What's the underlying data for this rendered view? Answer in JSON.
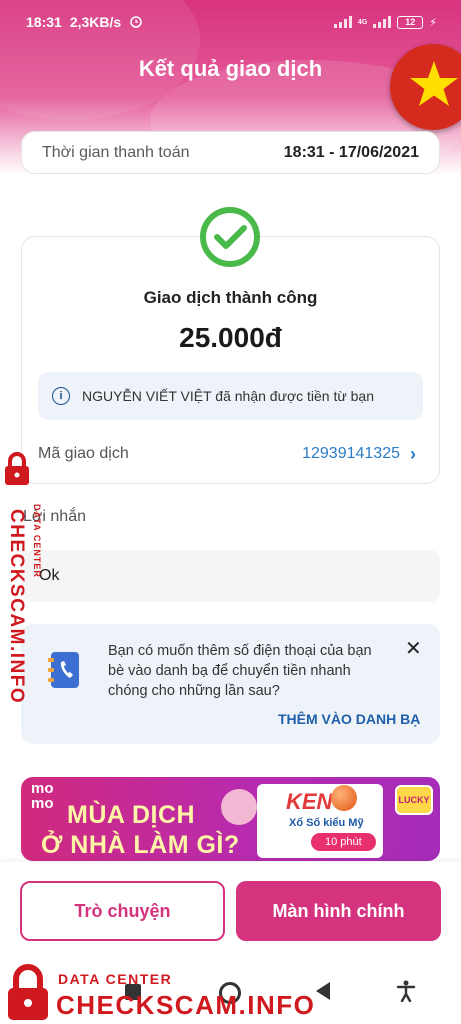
{
  "status_bar": {
    "time": "18:31",
    "network_speed": "2,3KB/s",
    "network_type": "4G",
    "battery": "12"
  },
  "header": {
    "title": "Kết quả giao dịch"
  },
  "payment_time": {
    "label": "Thời gian thanh toán",
    "value": "18:31 - 17/06/2021"
  },
  "result": {
    "status": "Giao dịch thành công",
    "amount": "25.000đ",
    "info": "NGUYỄN VIẾT VIỆT đã nhận được tiền từ bạn",
    "transaction_label": "Mã giao dịch",
    "transaction_id": "12939141325"
  },
  "message": {
    "label": "Lời nhắn",
    "value": "Ok"
  },
  "contact_prompt": {
    "text": "Bạn có muốn thêm số điện thoại của bạn bè vào danh bạ để chuyển tiền nhanh chóng cho những lần sau?",
    "action": "THÊM VÀO DANH BẠ"
  },
  "banner": {
    "brand": "mo mo",
    "line1": "MÙA DỊCH",
    "line2": "Ở NHÀ LÀM GÌ?",
    "game": "KENO",
    "subtitle": "Xổ Số kiểu Mỹ",
    "frequency": "10 phút",
    "badge": "LUCKY"
  },
  "buttons": {
    "chat": "Trò chuyện",
    "home": "Màn hình chính"
  },
  "watermark": {
    "small": "DATA CENTER",
    "big": "CHECKSCAM.INFO"
  },
  "colors": {
    "brand_pink": "#d6337f",
    "link_blue": "#2a7cc7",
    "success_green": "#49b94a",
    "watermark_red": "#d0191e"
  }
}
